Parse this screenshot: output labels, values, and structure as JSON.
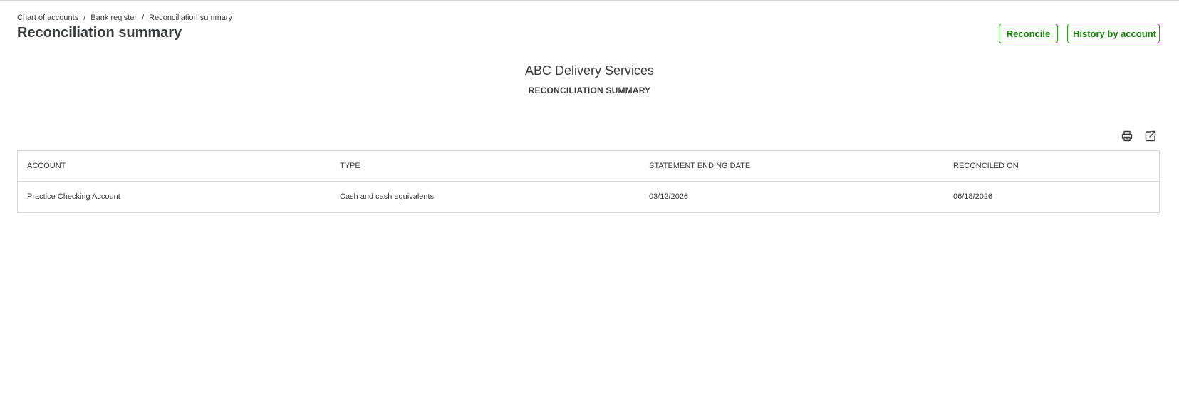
{
  "breadcrumb": {
    "items": [
      {
        "label": "Chart of accounts"
      },
      {
        "label": "Bank register"
      }
    ],
    "separator": "/",
    "current": "Reconciliation summary"
  },
  "page": {
    "title": "Reconciliation summary"
  },
  "actions": {
    "reconcile_label": "Reconcile",
    "history_label": "History by account"
  },
  "report": {
    "company_name": "ABC Delivery Services",
    "title": "RECONCILIATION SUMMARY"
  },
  "toolbar": {
    "print_icon": "printer-icon",
    "export_icon": "export-icon"
  },
  "table": {
    "columns": [
      "ACCOUNT",
      "TYPE",
      "STATEMENT ENDING DATE",
      "RECONCILED ON"
    ],
    "rows": [
      [
        "Practice Checking Account",
        "Cash and cash equivalents",
        "03/12/2026",
        "06/18/2026"
      ]
    ]
  },
  "colors": {
    "accent": "#2ca01c",
    "accent_text": "#108000",
    "text": "#393a3d",
    "border": "#d4d7dc"
  }
}
